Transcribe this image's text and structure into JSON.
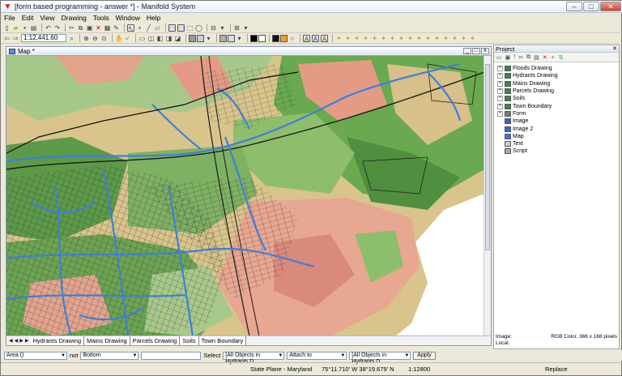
{
  "window": {
    "title": "[form based programming - answer *] - Manifold System"
  },
  "menu": [
    "File",
    "Edit",
    "View",
    "Drawing",
    "Tools",
    "Window",
    "Help"
  ],
  "toolbar": {
    "scale": "1:12,441.60"
  },
  "map_window": {
    "title": "Map *",
    "layer_tabs": [
      "Hydrants Drawing",
      "Mains Drawing",
      "Parcels Drawing",
      "Soils",
      "Town Boundary"
    ]
  },
  "project": {
    "title": "Project",
    "items": [
      {
        "label": "Floods Drawing",
        "expandable": true,
        "color": "#3a8a3a"
      },
      {
        "label": "Hydrants Drawing",
        "expandable": true,
        "color": "#3a8a3a"
      },
      {
        "label": "Mains Drawing",
        "expandable": true,
        "color": "#3a8a3a"
      },
      {
        "label": "Parcels Drawing",
        "expandable": true,
        "color": "#3a8a3a"
      },
      {
        "label": "Soils",
        "expandable": true,
        "color": "#3a8a3a"
      },
      {
        "label": "Town Boundary",
        "expandable": true,
        "color": "#3a8a3a"
      },
      {
        "label": "Form",
        "expandable": true,
        "color": "#777777"
      },
      {
        "label": "Image",
        "expandable": false,
        "color": "#3366cc"
      },
      {
        "label": "Image 2",
        "expandable": false,
        "color": "#3366cc"
      },
      {
        "label": "Map",
        "expandable": false,
        "color": "#4477dd"
      },
      {
        "label": "Text",
        "expandable": false,
        "color": "#cccccc"
      },
      {
        "label": "Script",
        "expandable": false,
        "color": "#aaaaaa"
      }
    ],
    "info_label": "Image:",
    "info_value": "RGB Color, 366 x 168 pixels",
    "info_location": "Local."
  },
  "select_bar": {
    "area": "Area ()",
    "not": "not",
    "bottom": "Bottom",
    "select": "Select",
    "objects1": "[All Objects in Hydrants D",
    "attach": "Attach to",
    "objects2": "[All Objects in Hydrants D",
    "apply": "Apply"
  },
  "status": {
    "projection": "State Plane - Maryland",
    "coords": "75°11.710' W 38°19.679' N",
    "scale": "1:12800",
    "mode": "Replace"
  },
  "colors": {
    "mains": "#3f7fd6",
    "parcels": "#2b2b2b",
    "soil_green": "#5aa14a",
    "soil_salmon": "#e4a08a"
  }
}
